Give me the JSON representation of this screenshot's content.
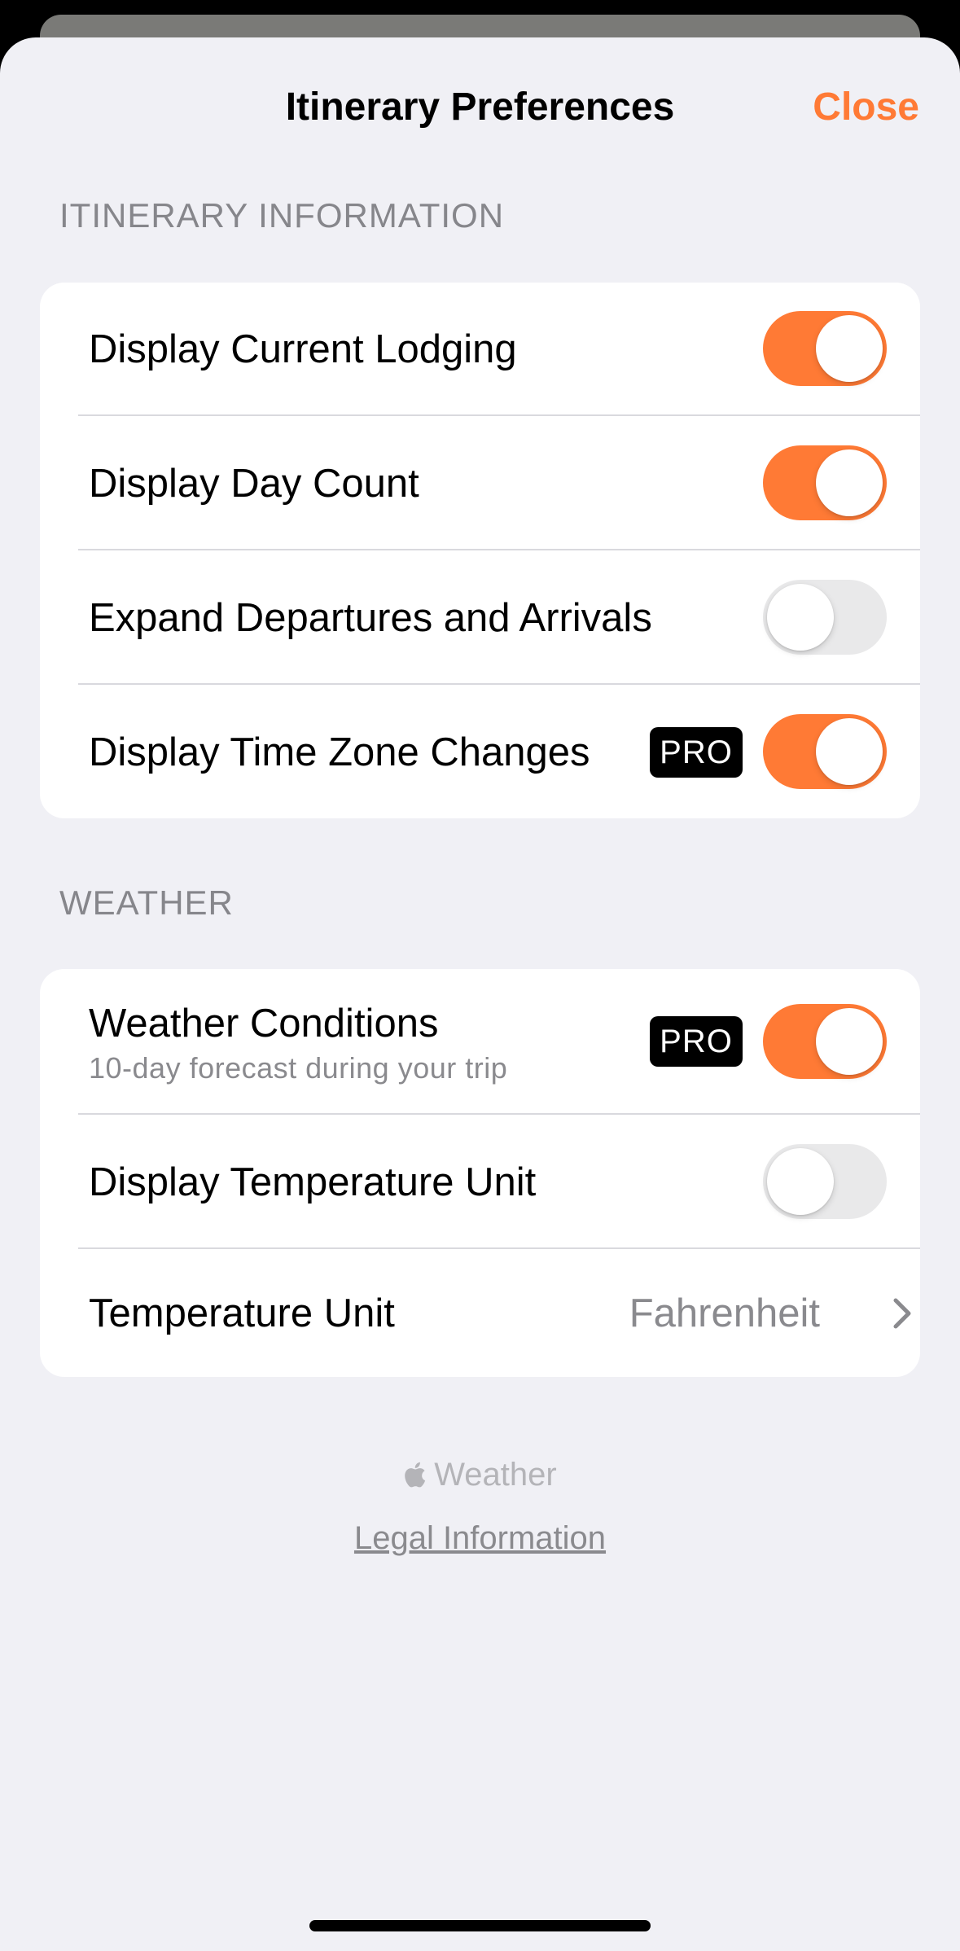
{
  "colors": {
    "accent": "#ff7a35",
    "background": "#f0f0f5",
    "pro_badge": "#000000"
  },
  "nav": {
    "title": "Itinerary Preferences",
    "close_label": "Close"
  },
  "itinerary": {
    "header": "ITINERARY INFORMATION",
    "rows": [
      {
        "label": "Display Current Lodging",
        "toggle": true,
        "pro": false
      },
      {
        "label": "Display Day Count",
        "toggle": true,
        "pro": false
      },
      {
        "label": "Expand Departures and Arrivals",
        "toggle": false,
        "pro": false
      },
      {
        "label": "Display Time Zone Changes",
        "toggle": true,
        "pro": true,
        "badge": "PRO"
      }
    ]
  },
  "weather": {
    "header": "WEATHER",
    "conditions": {
      "label": "Weather Conditions",
      "subtitle": "10-day forecast during your trip",
      "badge": "PRO",
      "toggle": true
    },
    "temp_unit_display": {
      "label": "Display Temperature Unit",
      "toggle": false
    },
    "temp_unit": {
      "label": "Temperature Unit",
      "value": "Fahrenheit",
      "icon": "chevron-right-icon"
    }
  },
  "footer": {
    "weather_credit": "Weather",
    "weather_credit_icon": "apple-logo-icon",
    "legal_link": "Legal Information"
  }
}
